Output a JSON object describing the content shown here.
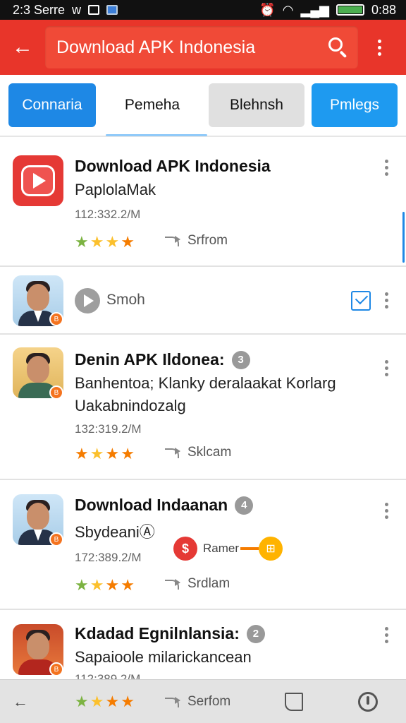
{
  "status_bar": {
    "time": "2:3 Serre",
    "left_glyph": "w",
    "right_time": "0:88"
  },
  "app_bar": {
    "back_symbol": "←",
    "title": "Download APK Indonesia"
  },
  "tabs": [
    {
      "label": "Connaria"
    },
    {
      "label": "Pemeha"
    },
    {
      "label": "Blehnsh"
    },
    {
      "label": "Pmlegs"
    }
  ],
  "items": [
    {
      "title": "Download APK Indonesia",
      "subtitle": "PaplolaMak",
      "meta": "112:332.2/M",
      "stars": [
        "★",
        "★",
        "★",
        "★"
      ],
      "action": "Srfrom"
    },
    {
      "label": "Smoh"
    },
    {
      "title": "Denin APK Ildonea:",
      "badge": "3",
      "subtitle": "Banhentoa; Klanky deralaakat Korlarg",
      "subtitle2": "Uakabnindozalg",
      "meta": "132:319.2/M",
      "stars": [
        "★",
        "★",
        "★",
        "★"
      ],
      "action": "Sklcam"
    },
    {
      "title": "Download Indaanan",
      "badge": "4",
      "subtitle": "SbydeaniⒶ",
      "meta": "172:389.2/M",
      "chip_symbol": "$",
      "chip_label": "Ramer",
      "stars": [
        "★",
        "★",
        "★",
        "★"
      ],
      "action": "Srdlam"
    },
    {
      "title": "Kdadad Egnilnlansia:",
      "badge": "2",
      "subtitle": "Sapaioole milarickancean",
      "meta": "112:389.2/M"
    }
  ],
  "bottom_bar": {
    "back_symbol": "←",
    "stars": [
      "★",
      "★",
      "★",
      "★"
    ],
    "action": "Serfom"
  },
  "colors": {
    "accent": "#e8352a",
    "blue": "#1e88e5",
    "star_green": "#7cb342",
    "star_yellow": "#fbc02d",
    "star_orange": "#f57c00"
  }
}
